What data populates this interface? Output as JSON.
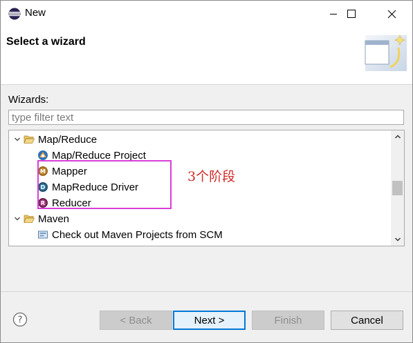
{
  "window": {
    "title": "New",
    "icon": "eclipse-icon"
  },
  "header": {
    "title": "Select a wizard",
    "banner_icon": "new-wizard-banner-icon"
  },
  "filter": {
    "label": "Wizards:",
    "placeholder": "type filter text",
    "value": ""
  },
  "tree": {
    "items": [
      {
        "label": "Map/Reduce",
        "level": 0,
        "expanded": true,
        "icon": "folder-open-icon"
      },
      {
        "label": "Map/Reduce Project",
        "level": 1,
        "icon": "mapreduce-project-icon"
      },
      {
        "label": "Mapper",
        "level": 1,
        "icon": "mapper-icon"
      },
      {
        "label": "MapReduce Driver",
        "level": 1,
        "icon": "driver-icon"
      },
      {
        "label": "Reducer",
        "level": 1,
        "icon": "reducer-icon"
      },
      {
        "label": "Maven",
        "level": 0,
        "expanded": true,
        "icon": "folder-open-icon"
      },
      {
        "label": "Check out Maven Projects from SCM",
        "level": 1,
        "icon": "maven-checkout-icon"
      }
    ]
  },
  "annotation": {
    "text": "3个阶段",
    "color": "#d22828",
    "box_color": "#d63fd6"
  },
  "buttons": {
    "back": "< Back",
    "next": "Next >",
    "finish": "Finish",
    "cancel": "Cancel"
  },
  "colors": {
    "default_button_border": "#0078d7"
  }
}
